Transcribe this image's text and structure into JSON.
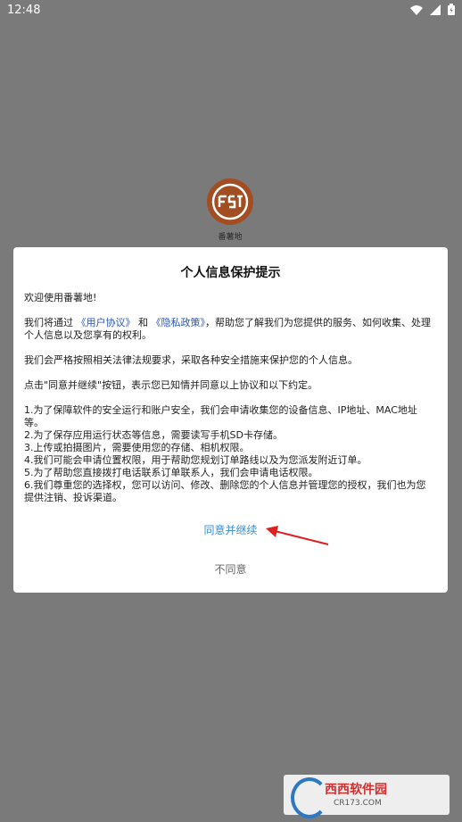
{
  "status_bar": {
    "time": "12:48"
  },
  "app": {
    "name": "番薯地"
  },
  "dialog": {
    "title": "个人信息保护提示",
    "greeting": "欢迎使用番薯地!",
    "intro": {
      "prefix": "我们将通过",
      "link_user_agreement": "《用户协议》",
      "and": "和",
      "link_privacy_policy": "《隐私政策》",
      "suffix": "，帮助您了解我们为您提供的服务、如何收集、处理个人信息以及您享有的权利。"
    },
    "commitment": "我们会严格按照相关法律法规要求，采取各种安全措施来保护您的个人信息。",
    "instruction": "点击\"同意并继续\"按钮，表示您已知情并同意以上协议和以下约定。",
    "items": [
      "1.为了保障软件的安全运行和账户安全，我们会申请收集您的设备信息、IP地址、MAC地址等。",
      "2.为了保存应用运行状态等信息，需要读写手机SD卡存储。",
      "3.上传或拍摄图片，需要使用您的存储、相机权限。",
      "4.我们可能会申请位置权限，用于帮助您规划订单路线以及为您派发附近订单。",
      "5.为了帮助您直接拨打电话联系订单联系人，我们会申请电话权限。",
      "6.我们尊重您的选择权，您可以访问、修改、删除您的个人信息并管理您的授权，我们也为您提供注销、投诉渠道。"
    ],
    "agree_label": "同意并继续",
    "disagree_label": "不同意"
  },
  "watermark": {
    "brand": "西西软件园",
    "url": "CR173.COM"
  },
  "colors": {
    "overlay": "#7a7a7a",
    "link": "#2a55b6",
    "agree": "#3a8fd0",
    "arrow": "#e02020",
    "logo": "#a24d22"
  }
}
